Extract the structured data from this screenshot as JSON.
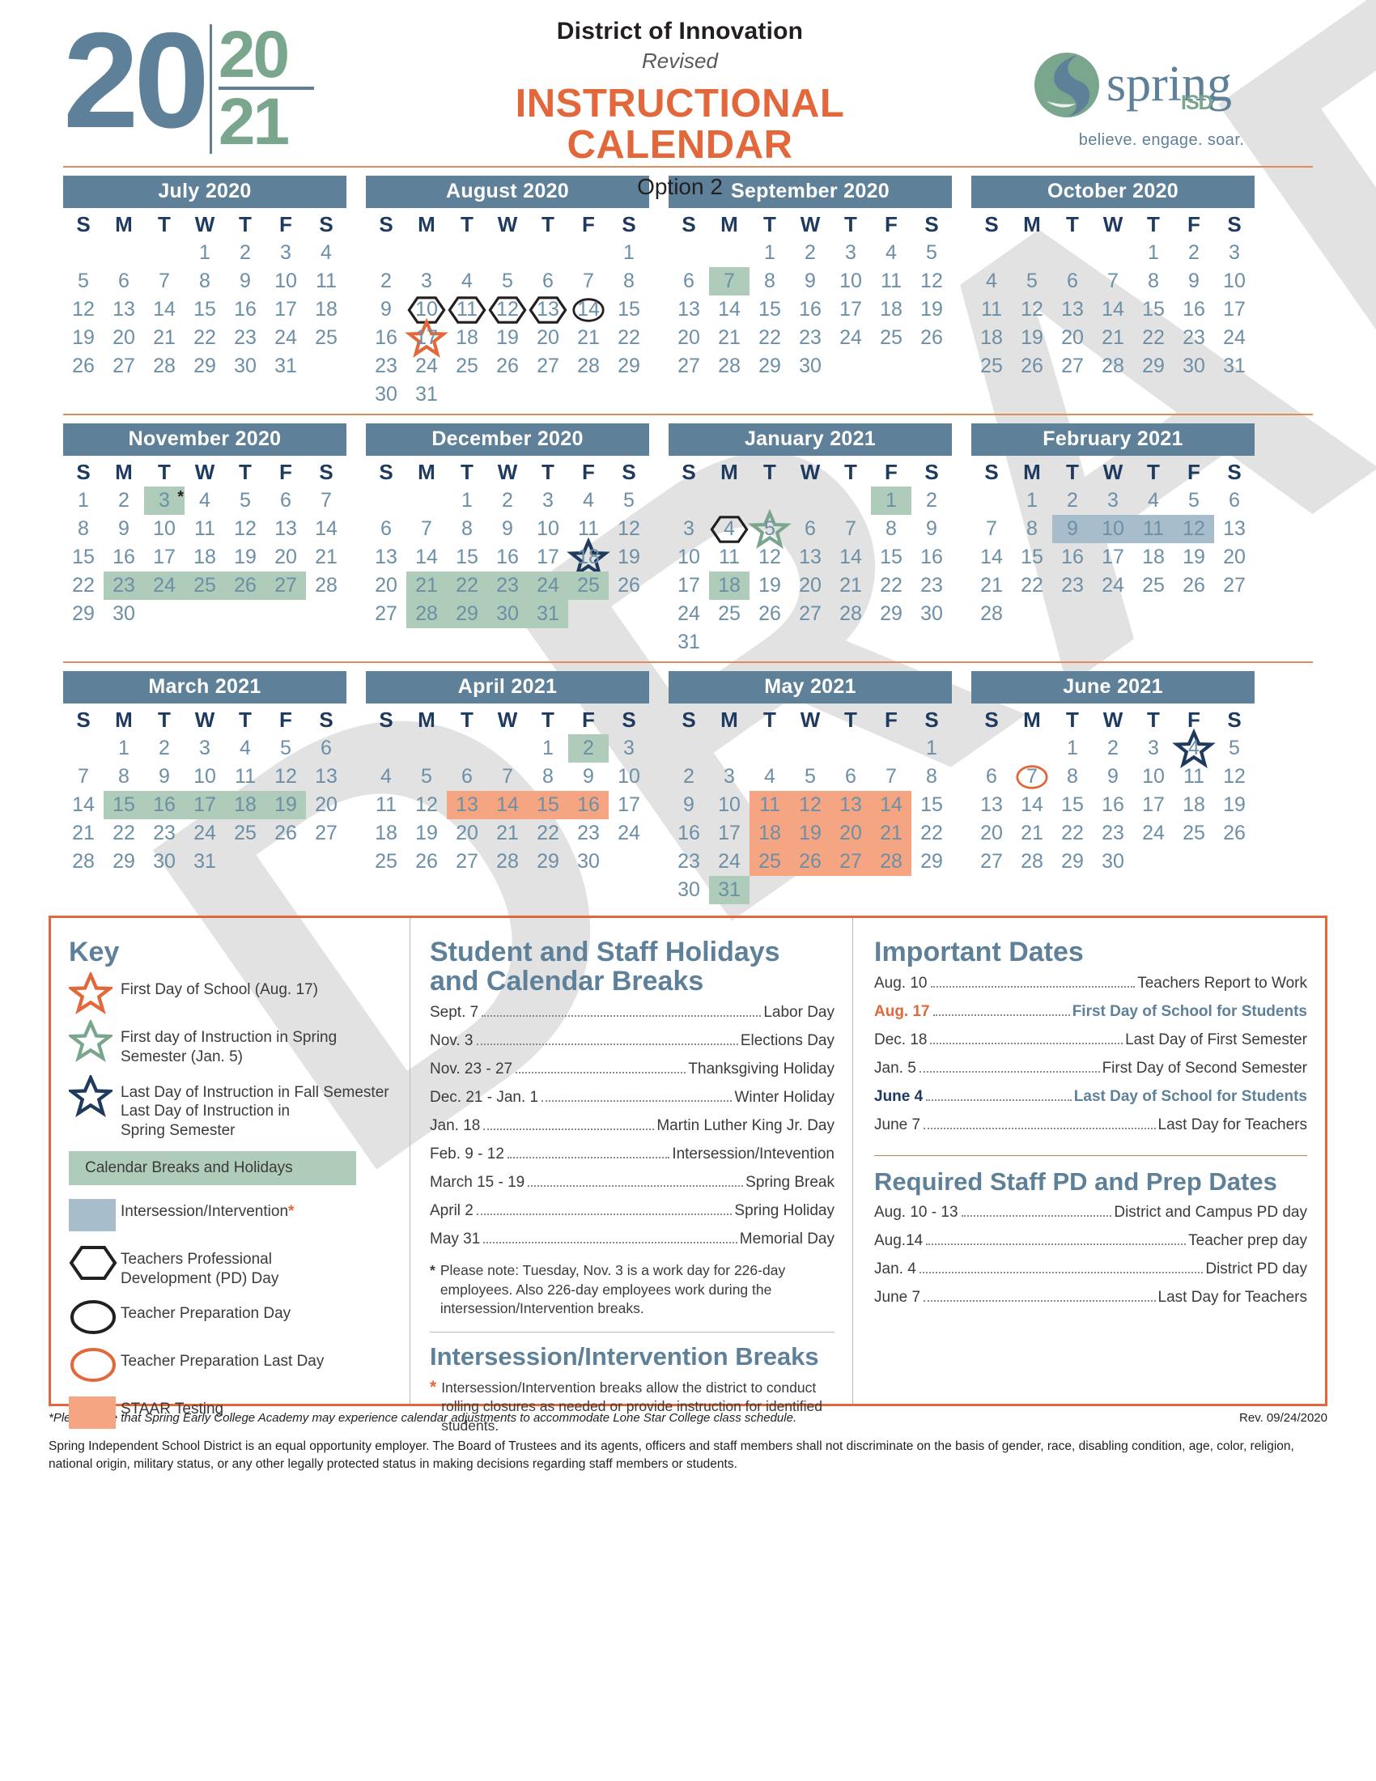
{
  "watermark_text": "DRAFT",
  "header": {
    "year_big": "20",
    "year_top": "20",
    "year_bottom": "21",
    "district_of_innovation": "District of Innovation",
    "revised": "Revised",
    "title_line1": "INSTRUCTIONAL",
    "title_line2": "CALENDAR",
    "option": "Option 2",
    "logo_word": "spring",
    "logo_isd": "ISD",
    "logo_tagline": "believe. engage. soar."
  },
  "weekday_headers": [
    "S",
    "M",
    "T",
    "W",
    "T",
    "F",
    "S"
  ],
  "months": [
    {
      "name": "July 2020",
      "lead_blanks": 3,
      "days": 31,
      "marks": {}
    },
    {
      "name": "August  2020",
      "lead_blanks": 6,
      "days": 31,
      "marks": {
        "10": {
          "shape": "hexagon",
          "color": "#231f20"
        },
        "11": {
          "shape": "hexagon",
          "color": "#231f20"
        },
        "12": {
          "shape": "hexagon",
          "color": "#231f20"
        },
        "13": {
          "shape": "hexagon",
          "color": "#231f20"
        },
        "14": {
          "shape": "circle",
          "color": "#231f20"
        },
        "17": {
          "shape": "star",
          "color": "#e2683c"
        }
      }
    },
    {
      "name": "September 2020",
      "lead_blanks": 2,
      "days": 30,
      "marks": {
        "7": {
          "shape": "fill",
          "color": "green"
        }
      }
    },
    {
      "name": "October 2020",
      "lead_blanks": 4,
      "days": 31,
      "marks": {}
    },
    {
      "name": "November 2020",
      "lead_blanks": 0,
      "days": 30,
      "marks": {
        "3": {
          "shape": "fill",
          "color": "green",
          "asterisk": "*"
        },
        "23": {
          "shape": "fill",
          "color": "green"
        },
        "24": {
          "shape": "fill",
          "color": "green"
        },
        "25": {
          "shape": "fill",
          "color": "green"
        },
        "26": {
          "shape": "fill",
          "color": "green"
        },
        "27": {
          "shape": "fill",
          "color": "green"
        }
      }
    },
    {
      "name": "December 2020",
      "lead_blanks": 2,
      "days": 31,
      "marks": {
        "18": {
          "shape": "star",
          "color": "#1f3a5f"
        },
        "21": {
          "shape": "fill",
          "color": "green"
        },
        "22": {
          "shape": "fill",
          "color": "green"
        },
        "23": {
          "shape": "fill",
          "color": "green"
        },
        "24": {
          "shape": "fill",
          "color": "green"
        },
        "25": {
          "shape": "fill",
          "color": "green"
        },
        "28": {
          "shape": "fill",
          "color": "green"
        },
        "29": {
          "shape": "fill",
          "color": "green"
        },
        "30": {
          "shape": "fill",
          "color": "green"
        },
        "31": {
          "shape": "fill",
          "color": "green"
        }
      }
    },
    {
      "name": "January  2021",
      "lead_blanks": 5,
      "days": 31,
      "marks": {
        "1": {
          "shape": "fill",
          "color": "green"
        },
        "4": {
          "shape": "hexagon",
          "color": "#231f20"
        },
        "5": {
          "shape": "star",
          "color": "#79a68c"
        },
        "18": {
          "shape": "fill",
          "color": "green"
        }
      }
    },
    {
      "name": "February 2021",
      "lead_blanks": 1,
      "days": 28,
      "marks": {
        "9": {
          "shape": "fill",
          "color": "blue"
        },
        "10": {
          "shape": "fill",
          "color": "blue"
        },
        "11": {
          "shape": "fill",
          "color": "blue"
        },
        "12": {
          "shape": "fill",
          "color": "blue"
        }
      }
    },
    {
      "name": "March 2021",
      "lead_blanks": 1,
      "days": 31,
      "marks": {
        "15": {
          "shape": "fill",
          "color": "green"
        },
        "16": {
          "shape": "fill",
          "color": "green"
        },
        "17": {
          "shape": "fill",
          "color": "green"
        },
        "18": {
          "shape": "fill",
          "color": "green"
        },
        "19": {
          "shape": "fill",
          "color": "green"
        }
      }
    },
    {
      "name": "April  2021",
      "lead_blanks": 4,
      "days": 30,
      "marks": {
        "2": {
          "shape": "fill",
          "color": "green"
        },
        "13": {
          "shape": "fill",
          "color": "orange"
        },
        "14": {
          "shape": "fill",
          "color": "orange"
        },
        "15": {
          "shape": "fill",
          "color": "orange"
        },
        "16": {
          "shape": "fill",
          "color": "orange"
        }
      }
    },
    {
      "name": "May 2021",
      "lead_blanks": 6,
      "days": 31,
      "marks": {
        "11": {
          "shape": "fill",
          "color": "orange"
        },
        "12": {
          "shape": "fill",
          "color": "orange"
        },
        "13": {
          "shape": "fill",
          "color": "orange"
        },
        "14": {
          "shape": "fill",
          "color": "orange"
        },
        "18": {
          "shape": "fill",
          "color": "orange"
        },
        "19": {
          "shape": "fill",
          "color": "orange"
        },
        "20": {
          "shape": "fill",
          "color": "orange"
        },
        "21": {
          "shape": "fill",
          "color": "orange"
        },
        "25": {
          "shape": "fill",
          "color": "orange"
        },
        "26": {
          "shape": "fill",
          "color": "orange"
        },
        "27": {
          "shape": "fill",
          "color": "orange"
        },
        "28": {
          "shape": "fill",
          "color": "orange"
        },
        "31": {
          "shape": "fill",
          "color": "green"
        }
      }
    },
    {
      "name": "June 2021",
      "lead_blanks": 2,
      "days": 30,
      "marks": {
        "4": {
          "shape": "star",
          "color": "#1f3a5f"
        },
        "7": {
          "shape": "circle",
          "color": "#e2683c"
        }
      }
    }
  ],
  "key": {
    "title": "Key",
    "items": [
      {
        "icon": "orange-star-icon",
        "label": "First Day of School (Aug. 17)"
      },
      {
        "icon": "green-star-icon",
        "label": "First day of Instruction in Spring\nSemester (Jan. 5)"
      },
      {
        "icon": "navy-star-icon",
        "label": "Last Day of Instruction in Fall Semester\nLast Day of Instruction in\nSpring Semester"
      }
    ],
    "band_label": "Calendar Breaks and Holidays",
    "swatch_items": [
      {
        "icon": "blue-swatch-icon",
        "label": "Intersession/Intervention",
        "suffix": "*"
      }
    ],
    "shape_items": [
      {
        "icon": "hexagon-icon",
        "label": "Teachers Professional\nDevelopment (PD) Day"
      },
      {
        "icon": "black-circle-icon",
        "label": "Teacher Preparation Day"
      },
      {
        "icon": "orange-circle-icon",
        "label": "Teacher Preparation Last Day"
      },
      {
        "icon": "orange-swatch-icon",
        "label": "STAAR Testing"
      }
    ]
  },
  "holidays": {
    "title": "Student and Staff Holidays\nand Calendar Breaks",
    "rows": [
      {
        "date": "Sept. 7",
        "label": "Labor Day"
      },
      {
        "date": "Nov. 3",
        "label": "Elections Day"
      },
      {
        "date": "Nov. 23 - 27",
        "label": "Thanksgiving Holiday"
      },
      {
        "date": "Dec. 21 - Jan. 1",
        "label": "Winter Holiday"
      },
      {
        "date": "Jan. 18",
        "label": "Martin Luther King Jr. Day"
      },
      {
        "date": "Feb. 9 - 12",
        "label": "Intersession/Intevention"
      },
      {
        "date": "March 15 - 19",
        "label": "Spring Break"
      },
      {
        "date": "April 2",
        "label": "Spring Holiday"
      },
      {
        "date": "May 31",
        "label": "Memorial Day"
      }
    ],
    "note": "Please note: Tuesday, Nov. 3 is a work day for 226-day employees. Also 226-day employees work during the intersession/Intervention breaks.",
    "note_bullet": "*",
    "intersession_title": "Intersession/Intervention Breaks",
    "intersession_bullet": "*",
    "intersession_note": "Intersession/Intervention breaks allow the district to conduct rolling closures as needed or provide instruction for identified students."
  },
  "important_dates": {
    "title": "Important Dates",
    "rows": [
      {
        "date": "Aug. 10",
        "label": "Teachers Report to Work",
        "emphasis": "none"
      },
      {
        "date": "Aug. 17",
        "label": "First Day of School for Students",
        "emphasis": "orange"
      },
      {
        "date": "Dec. 18",
        "label": "Last Day of First Semester",
        "emphasis": "none"
      },
      {
        "date": "Jan. 5",
        "label": "First Day of Second Semester",
        "emphasis": "none"
      },
      {
        "date": "June 4",
        "label": "Last Day of School for Students",
        "emphasis": "navy"
      },
      {
        "date": "June 7",
        "label": "Last Day for Teachers",
        "emphasis": "none"
      }
    ]
  },
  "pd_dates": {
    "title": "Required Staff PD and Prep Dates",
    "rows": [
      {
        "date": "Aug. 10 - 13",
        "label": "District and Campus PD day"
      },
      {
        "date": "Aug.14",
        "label": "Teacher prep day"
      },
      {
        "date": "Jan. 4",
        "label": "District PD day"
      },
      {
        "date": "June 7",
        "label": "Last Day for Teachers"
      }
    ]
  },
  "footer": {
    "note": "*Please note that Spring Early College Academy may experience calendar adjustments to accommodate Lone Star College class schedule.",
    "rev": "Rev. 09/24/2020",
    "legal": "Spring Independent School District is an equal opportunity employer. The Board of Trustees and its agents, officers and staff members shall not discriminate on the basis of gender, race, disabling condition, age, color, religion, national origin, military status, or any other legally protected status in making decisions regarding staff members or students."
  },
  "colors": {
    "blue": "#5e8199",
    "navy": "#1f3a5f",
    "green": "#79a68c",
    "orange": "#e2683c",
    "fill_green": "#afcbb9",
    "fill_blue": "#a8bdcb",
    "fill_orange": "#f6a583"
  }
}
